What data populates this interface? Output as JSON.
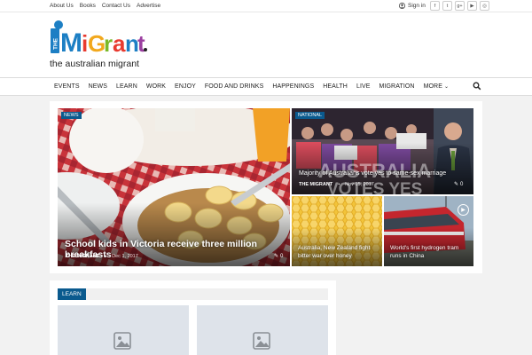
{
  "topbar": {
    "links": [
      "About Us",
      "Books",
      "Contact Us",
      "Advertise"
    ],
    "signin": "Sign in",
    "socials": [
      "facebook-icon",
      "twitter-icon",
      "google-plus-icon",
      "youtube-icon",
      "instagram-icon"
    ]
  },
  "logo": {
    "the": "THE",
    "word": "MIGRANT",
    "tagline": "the australian migrant"
  },
  "nav": {
    "items": [
      "EVENTS",
      "NEWS",
      "LEARN",
      "WORK",
      "ENJOY",
      "FOOD AND DRINKS",
      "HAPPENINGS",
      "HEALTH",
      "LIVE",
      "MIGRATION",
      "MORE"
    ]
  },
  "featured": {
    "main": {
      "category": "NEWS",
      "title": "School kids in Victoria receive three million breakfasts",
      "author": "THE MIGRANT",
      "date": "Dec 1, 2017",
      "comments": "0"
    },
    "top_right": {
      "category": "NATIONAL",
      "title": "Majority of Australians vote yes to same-sex marriage",
      "author": "THE MIGRANT",
      "date": "Nov 15, 2017",
      "comments": "0",
      "overlay_line1": "AUSTRALIA",
      "overlay_line2": "VOTES YES"
    },
    "bottom_left": {
      "title": "Australia, New Zealand fight bitter war over honey"
    },
    "bottom_right": {
      "title": "World's first hydrogen tram runs in China"
    }
  },
  "learn": {
    "tag": "LEARN"
  }
}
